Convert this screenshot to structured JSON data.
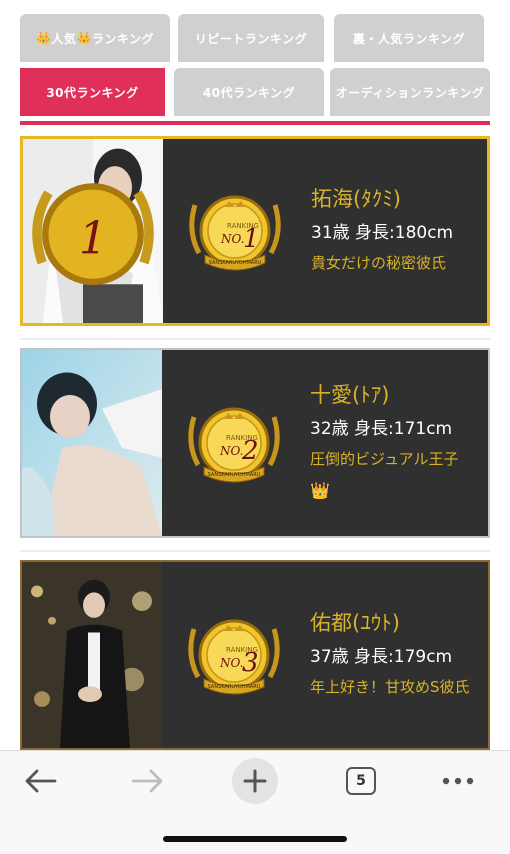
{
  "tabs": [
    {
      "label": "人気",
      "icon": "crown-icon",
      "suffix": "ランキング",
      "active": false
    },
    {
      "label": "リピートランキング",
      "active": false
    },
    {
      "label": "裏・人気ランキング",
      "active": false
    },
    {
      "label": "30代ランキング",
      "active": true
    },
    {
      "label": "40代ランキング",
      "active": false
    },
    {
      "label": "オーディションランキング",
      "active": false
    }
  ],
  "ranking": [
    {
      "rank": "1",
      "medal_text": "RANKING NO.1",
      "medal_sub": "SANSKARUYOHMARU",
      "name": "拓海(ﾀｸﾐ)",
      "stats": "31歳 身長:180cm",
      "tagline": "貴女だけの秘密彼氏",
      "frame": "gold"
    },
    {
      "rank": "2",
      "medal_text": "RANKING NO.2",
      "medal_sub": "SANSKARUYOHMARU",
      "name": "十愛(ﾄｱ)",
      "stats": "32歳 身長:171cm",
      "tagline": "圧倒的ビジュアル王子",
      "tag_icon": "crown-icon",
      "frame": "silver"
    },
    {
      "rank": "3",
      "medal_text": "RANKING NO.3",
      "medal_sub": "SANSKARUYOHMARU",
      "name": "佑都(ﾕｳﾄ)",
      "stats": "37歳 身長:179cm",
      "tagline": "年上好き！甘攻めS彼氏",
      "frame": "bronze"
    }
  ],
  "toolbar": {
    "back": "back-arrow-icon",
    "forward": "forward-arrow-icon",
    "new_tab": "plus-icon",
    "tab_count": "5",
    "menu": "more-icon"
  },
  "colors": {
    "accent": "#e0305a",
    "gold": "#d8b227",
    "card_bg": "#303030"
  }
}
